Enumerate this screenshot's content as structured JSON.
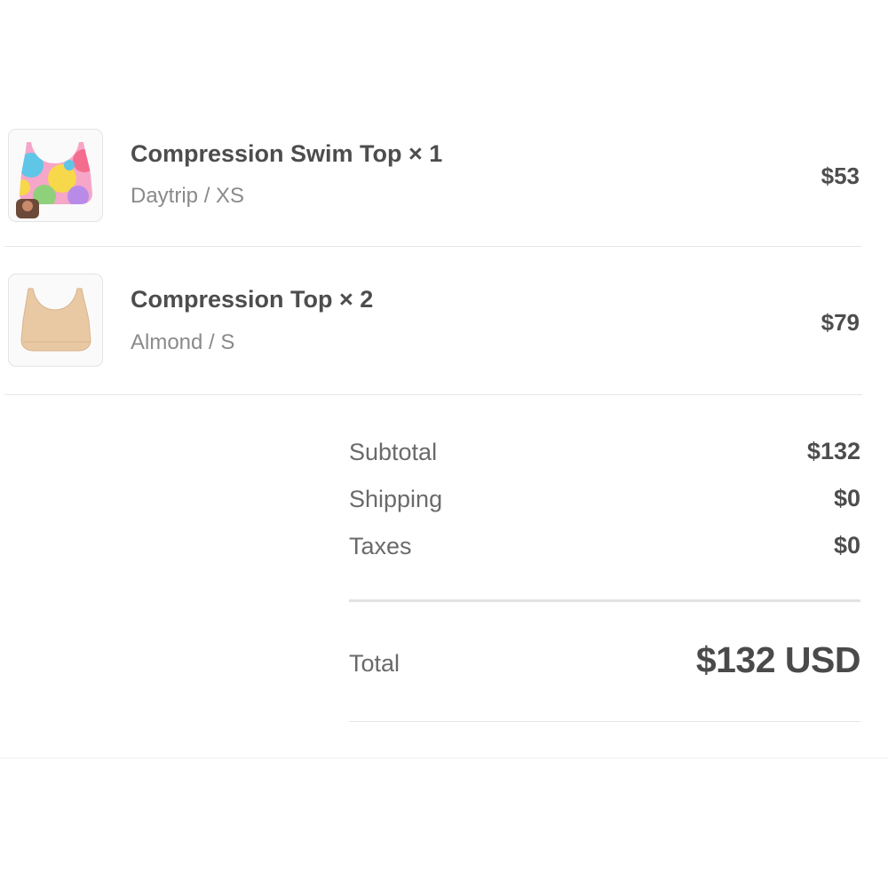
{
  "cart": {
    "items": [
      {
        "name": "Compression Swim Top × 1",
        "variant": "Daytrip / XS",
        "price": "$53",
        "image_icon": "colorful-swim-top-thumbnail"
      },
      {
        "name": "Compression Top × 2",
        "variant": "Almond / S",
        "price": "$79",
        "image_icon": "almond-top-thumbnail"
      }
    ]
  },
  "summary": {
    "subtotal_label": "Subtotal",
    "subtotal_value": "$132",
    "shipping_label": "Shipping",
    "shipping_value": "$0",
    "taxes_label": "Taxes",
    "taxes_value": "$0",
    "total_label": "Total",
    "total_value": "$132 USD"
  },
  "colors": {
    "text_primary": "#4d4d4d",
    "text_secondary": "#8a8a8a",
    "divider": "#e6e6e6",
    "almond": "#e8c9a4"
  }
}
